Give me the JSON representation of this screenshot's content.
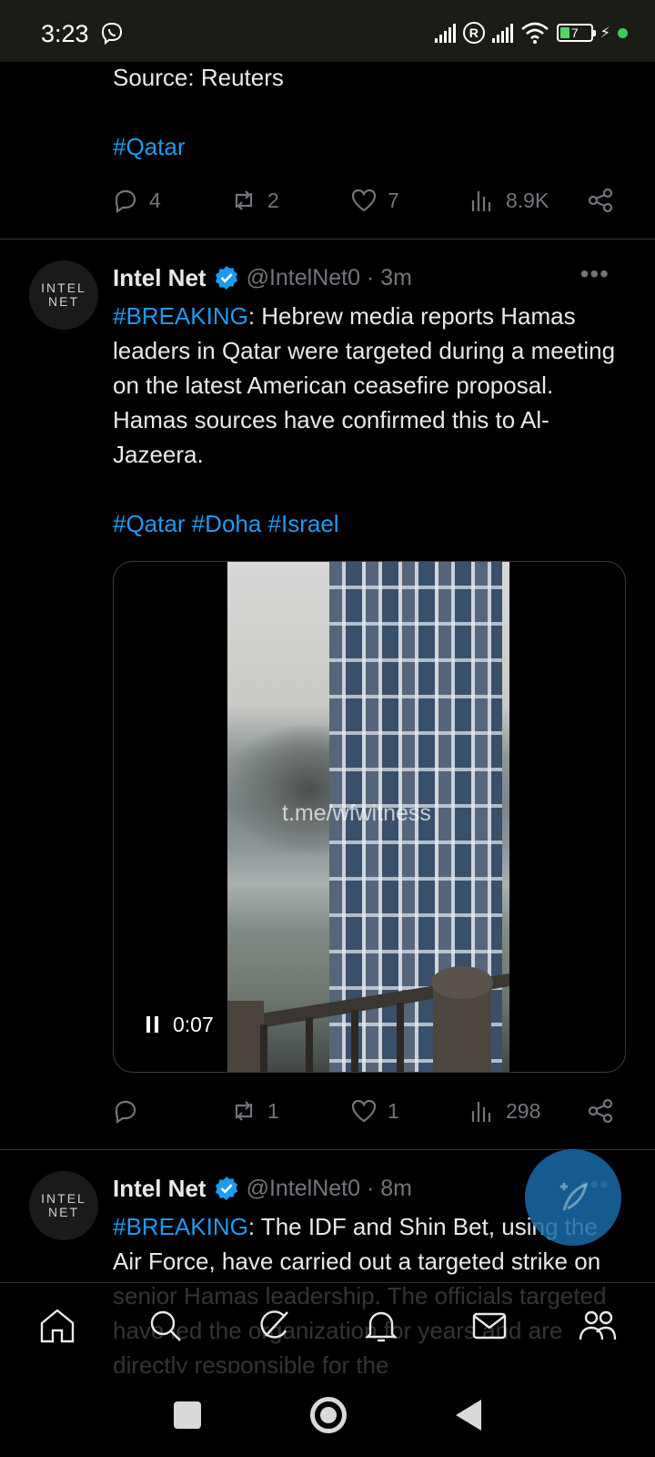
{
  "status_bar": {
    "time": "3:23",
    "battery_level": "7",
    "icons": [
      "viber-icon",
      "signal-icon",
      "roaming-icon",
      "signal-icon",
      "wifi-icon",
      "battery-icon",
      "charging-icon"
    ]
  },
  "tweets": [
    {
      "body_tail": "Source: Reuters",
      "hashtags": "#Qatar",
      "actions": {
        "replies": "4",
        "retweets": "2",
        "likes": "7",
        "views": "8.9K"
      }
    },
    {
      "name": "Intel Net",
      "handle_time": "@IntelNet0 · 3m",
      "avatar_line1": "INTEL",
      "avatar_line2": "NET",
      "tag": "#BREAKING",
      "body": ": Hebrew media reports Hamas leaders in Qatar were targeted during a meeting on the latest American ceasefire proposal. Hamas sources have confirmed this to Al-Jazeera.",
      "hashtags": "#Qatar #Doha #Israel",
      "video": {
        "watermark": "t.me/wfwitness",
        "time": "0:07"
      },
      "actions": {
        "replies": "",
        "retweets": "1",
        "likes": "1",
        "views": "298"
      }
    },
    {
      "name": "Intel Net",
      "handle_time": "@IntelNet0 · 8m",
      "avatar_line1": "INTEL",
      "avatar_line2": "NET",
      "tag": "#BREAKING",
      "body": ": The IDF and Shin Bet, using the Air Force, have carried out a targeted strike on senior Hamas leadership. The officials targeted have led the organization for years and are directly responsible for the"
    }
  ],
  "accent_color": "#1d9bf0",
  "nav_tabs": [
    "home-icon",
    "search-icon",
    "grok-icon",
    "notifications-icon",
    "messages-icon",
    "communities-icon"
  ]
}
